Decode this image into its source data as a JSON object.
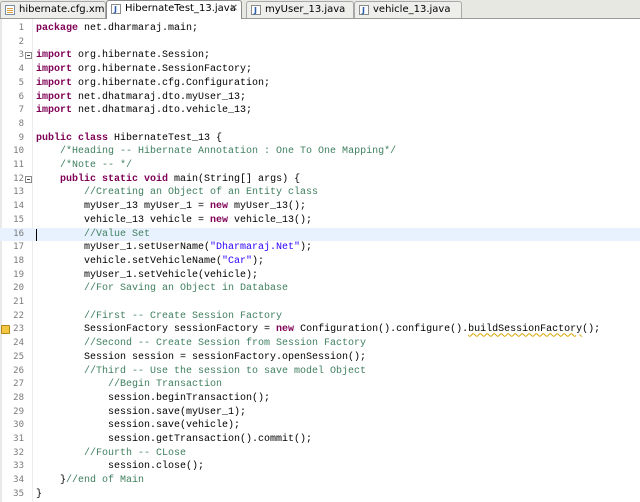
{
  "tabs": [
    {
      "label": "hibernate.cfg.xml",
      "icon": "xml-file-icon",
      "active": false,
      "closable": false
    },
    {
      "label": "HibernateTest_13.java",
      "icon": "java-file-icon",
      "active": true,
      "closable": true
    },
    {
      "label": "myUser_13.java",
      "icon": "java-file-icon",
      "active": false,
      "closable": false
    },
    {
      "label": "vehicle_13.java",
      "icon": "java-file-icon",
      "active": false,
      "closable": false
    }
  ],
  "close_glyph": "✕",
  "colors": {
    "keyword": "#7f0055",
    "comment": "#3f7f5f",
    "string": "#2a00ff",
    "current_line": "#e8f2fe",
    "warning": "#f3c742"
  },
  "editor": {
    "current_line": 16,
    "lines": [
      {
        "n": "1",
        "tokens": [
          {
            "t": "package",
            "k": "kw"
          },
          {
            "t": " net.dharmaraj.main;"
          }
        ]
      },
      {
        "n": "2",
        "tokens": []
      },
      {
        "n": "3",
        "fold": true,
        "tokens": [
          {
            "t": "import",
            "k": "kw"
          },
          {
            "t": " org.hibernate.Session;"
          }
        ]
      },
      {
        "n": "4",
        "tokens": [
          {
            "t": "import",
            "k": "kw"
          },
          {
            "t": " org.hibernate.SessionFactory;"
          }
        ]
      },
      {
        "n": "5",
        "tokens": [
          {
            "t": "import",
            "k": "kw"
          },
          {
            "t": " org.hibernate.cfg.Configuration;"
          }
        ]
      },
      {
        "n": "6",
        "tokens": [
          {
            "t": "import",
            "k": "kw"
          },
          {
            "t": " net.dhatmaraj.dto.myUser_13;"
          }
        ]
      },
      {
        "n": "7",
        "tokens": [
          {
            "t": "import",
            "k": "kw"
          },
          {
            "t": " net.dhatmaraj.dto.vehicle_13;"
          }
        ]
      },
      {
        "n": "8",
        "tokens": []
      },
      {
        "n": "9",
        "tokens": [
          {
            "t": "public class",
            "k": "kw"
          },
          {
            "t": " HibernateTest_13 {"
          }
        ]
      },
      {
        "n": "10",
        "tokens": [
          {
            "t": "    "
          },
          {
            "t": "/*Heading -- Hibernate Annotation : One To One Mapping*/",
            "k": "cm"
          }
        ]
      },
      {
        "n": "11",
        "tokens": [
          {
            "t": "    "
          },
          {
            "t": "/*Note -- */",
            "k": "cm"
          }
        ]
      },
      {
        "n": "12",
        "fold": true,
        "tokens": [
          {
            "t": "    "
          },
          {
            "t": "public static void",
            "k": "kw"
          },
          {
            "t": " main(String[] args) {"
          }
        ]
      },
      {
        "n": "13",
        "tokens": [
          {
            "t": "        "
          },
          {
            "t": "//Creating an Object of an Entity class",
            "k": "cm"
          }
        ]
      },
      {
        "n": "14",
        "tokens": [
          {
            "t": "        myUser_13 myUser_1 = "
          },
          {
            "t": "new",
            "k": "kw"
          },
          {
            "t": " myUser_13();"
          }
        ]
      },
      {
        "n": "15",
        "tokens": [
          {
            "t": "        vehicle_13 vehicle = "
          },
          {
            "t": "new",
            "k": "kw"
          },
          {
            "t": " vehicle_13();"
          }
        ]
      },
      {
        "n": "16",
        "tokens": [
          {
            "t": "        "
          },
          {
            "t": "//Value Set",
            "k": "cm"
          }
        ]
      },
      {
        "n": "17",
        "tokens": [
          {
            "t": "        myUser_1.setUserName("
          },
          {
            "t": "\"Dharmaraj.Net\"",
            "k": "str"
          },
          {
            "t": ");"
          }
        ]
      },
      {
        "n": "18",
        "tokens": [
          {
            "t": "        vehicle.setVehicleName("
          },
          {
            "t": "\"Car\"",
            "k": "str"
          },
          {
            "t": ");"
          }
        ]
      },
      {
        "n": "19",
        "tokens": [
          {
            "t": "        myUser_1.setVehicle(vehicle);"
          }
        ]
      },
      {
        "n": "20",
        "tokens": [
          {
            "t": "        "
          },
          {
            "t": "//For Saving an Object in Database",
            "k": "cm"
          }
        ]
      },
      {
        "n": "21",
        "tokens": []
      },
      {
        "n": "22",
        "tokens": [
          {
            "t": "        "
          },
          {
            "t": "//First -- Create Session Factory",
            "k": "cm"
          }
        ]
      },
      {
        "n": "23",
        "warning": true,
        "tokens": [
          {
            "t": "        SessionFactory sessionFactory = "
          },
          {
            "t": "new",
            "k": "kw"
          },
          {
            "t": " Configuration().configure()."
          },
          {
            "t": "buildSessionFactory",
            "k": "warn"
          },
          {
            "t": "();"
          }
        ]
      },
      {
        "n": "24",
        "tokens": [
          {
            "t": "        "
          },
          {
            "t": "//Second -- Create Session from Session Factory",
            "k": "cm"
          }
        ]
      },
      {
        "n": "25",
        "tokens": [
          {
            "t": "        Session session = sessionFactory.openSession();"
          }
        ]
      },
      {
        "n": "26",
        "tokens": [
          {
            "t": "        "
          },
          {
            "t": "//Third -- Use the session to save model Object",
            "k": "cm"
          }
        ]
      },
      {
        "n": "27",
        "tokens": [
          {
            "t": "            "
          },
          {
            "t": "//Begin Transaction",
            "k": "cm"
          }
        ]
      },
      {
        "n": "28",
        "tokens": [
          {
            "t": "            session.beginTransaction();"
          }
        ]
      },
      {
        "n": "29",
        "tokens": [
          {
            "t": "            session.save(myUser_1);"
          }
        ]
      },
      {
        "n": "30",
        "tokens": [
          {
            "t": "            session.save(vehicle);"
          }
        ]
      },
      {
        "n": "31",
        "tokens": [
          {
            "t": "            session.getTransaction().commit();"
          }
        ]
      },
      {
        "n": "32",
        "tokens": [
          {
            "t": "        "
          },
          {
            "t": "//Fourth -- CLose",
            "k": "cm"
          }
        ]
      },
      {
        "n": "33",
        "tokens": [
          {
            "t": "            session.close();"
          }
        ]
      },
      {
        "n": "34",
        "tokens": [
          {
            "t": "    }"
          },
          {
            "t": "//end of Main",
            "k": "cm"
          }
        ]
      },
      {
        "n": "35",
        "tokens": [
          {
            "t": "}"
          }
        ]
      }
    ]
  }
}
